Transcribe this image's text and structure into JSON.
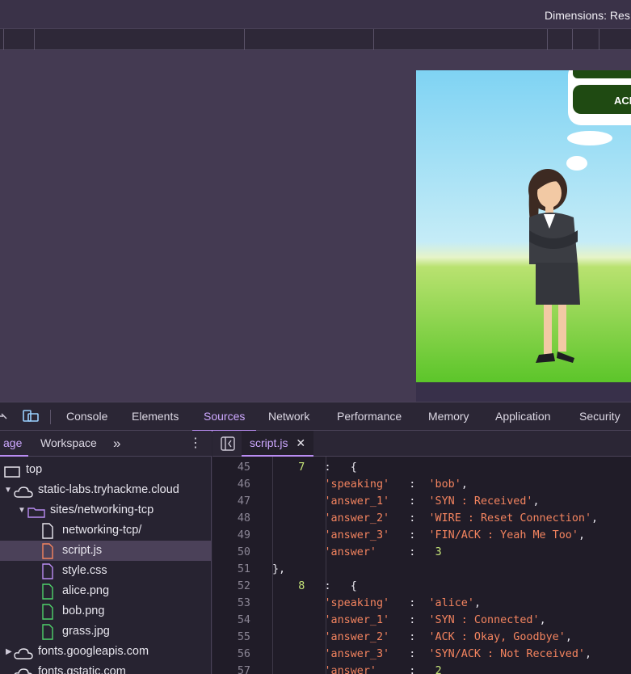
{
  "toolbar": {
    "dimensions_text": "Dimensions: Res"
  },
  "devtools": {
    "tabs": [
      "Console",
      "Elements",
      "Sources",
      "Network",
      "Performance",
      "Memory",
      "Application",
      "Security"
    ],
    "active_tab": "Sources"
  },
  "navigator": {
    "tabs": [
      "age",
      "Workspace"
    ],
    "more": "»",
    "tree": [
      {
        "label": "top",
        "type": "frame"
      },
      {
        "label": "static-labs.tryhackme.cloud",
        "type": "domain",
        "expanded": true
      },
      {
        "label": "sites/networking-tcp",
        "type": "folder",
        "expanded": true
      },
      {
        "label": "networking-tcp/",
        "type": "document"
      },
      {
        "label": "script.js",
        "type": "script",
        "selected": true
      },
      {
        "label": "style.css",
        "type": "stylesheet"
      },
      {
        "label": "alice.png",
        "type": "image"
      },
      {
        "label": "bob.png",
        "type": "image"
      },
      {
        "label": "grass.jpg",
        "type": "image"
      },
      {
        "label": "fonts.googleapis.com",
        "type": "domain",
        "expanded": false
      },
      {
        "label": "fonts.gstatic.com",
        "type": "domain",
        "expanded": false
      }
    ]
  },
  "editor": {
    "open_file": "script.js",
    "lines": [
      {
        "n": "45",
        "t": "    7   :   {"
      },
      {
        "n": "46",
        "t": "        'speaking'   :  'bob',"
      },
      {
        "n": "47",
        "t": "        'answer_1'   :  'SYN : Received',"
      },
      {
        "n": "48",
        "t": "        'answer_2'   :  'WIRE : Reset Connection',"
      },
      {
        "n": "49",
        "t": "        'answer_3'   :  'FIN/ACK : Yeah Me Too',"
      },
      {
        "n": "50",
        "t": "        'answer'     :   3"
      },
      {
        "n": "51",
        "t": "},",
        "indent": 0
      },
      {
        "n": "52",
        "t": "    8   :   {"
      },
      {
        "n": "53",
        "t": "        'speaking'   :  'alice',"
      },
      {
        "n": "54",
        "t": "        'answer_1'   :  'SYN : Connected',"
      },
      {
        "n": "55",
        "t": "        'answer_2'   :  'ACK : Okay, Goodbye',"
      },
      {
        "n": "56",
        "t": "        'answer_3'   :  'SYN/ACK : Not Received',"
      },
      {
        "n": "57",
        "t": "        'answer'     :   2"
      }
    ]
  },
  "preview": {
    "button_label": "ACK"
  }
}
